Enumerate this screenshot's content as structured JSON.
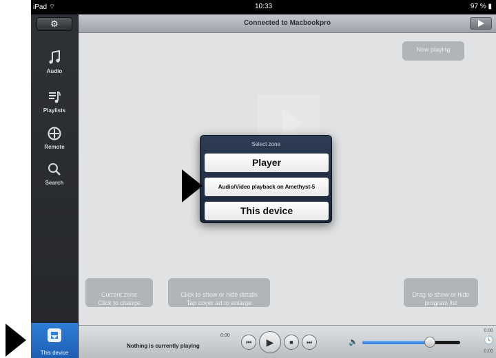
{
  "status_bar": {
    "carrier": "iPad ⌔",
    "time": "10:33",
    "battery": "97 % ▮"
  },
  "sidebar": {
    "settings_icon": "gear-icon",
    "items": [
      {
        "label": "Audio",
        "icon": "music-note-icon"
      },
      {
        "label": "Playlists",
        "icon": "playlist-icon"
      },
      {
        "label": "Remote",
        "icon": "remote-icon"
      },
      {
        "label": "Search",
        "icon": "search-icon"
      }
    ],
    "device_tab": {
      "label": "This device",
      "icon": "device-icon"
    }
  },
  "header": {
    "title": "Connected to Macbookpro"
  },
  "hints": {
    "now_playing": "Now playing",
    "current_zone": "Current zone\nClick to change",
    "artist_info": "Click to show or hide details\nTap cover art to enlarge",
    "program": "Drag to show or hide\nprogram list"
  },
  "zone_popup": {
    "title": "Select zone",
    "options": [
      "Player",
      "Audio/Video playback on Amethyst-5",
      "This device"
    ]
  },
  "player": {
    "now_playing_text": "Nothing is currently playing",
    "elapsed": "0:00",
    "remaining_top": "0:00",
    "remaining_bottom": "0:00",
    "volume_fraction": 0.69
  },
  "colors": {
    "sidebar_bg": "#2e3135",
    "accent_blue": "#2f7ed8",
    "popup_bg": "#1f2b40"
  }
}
